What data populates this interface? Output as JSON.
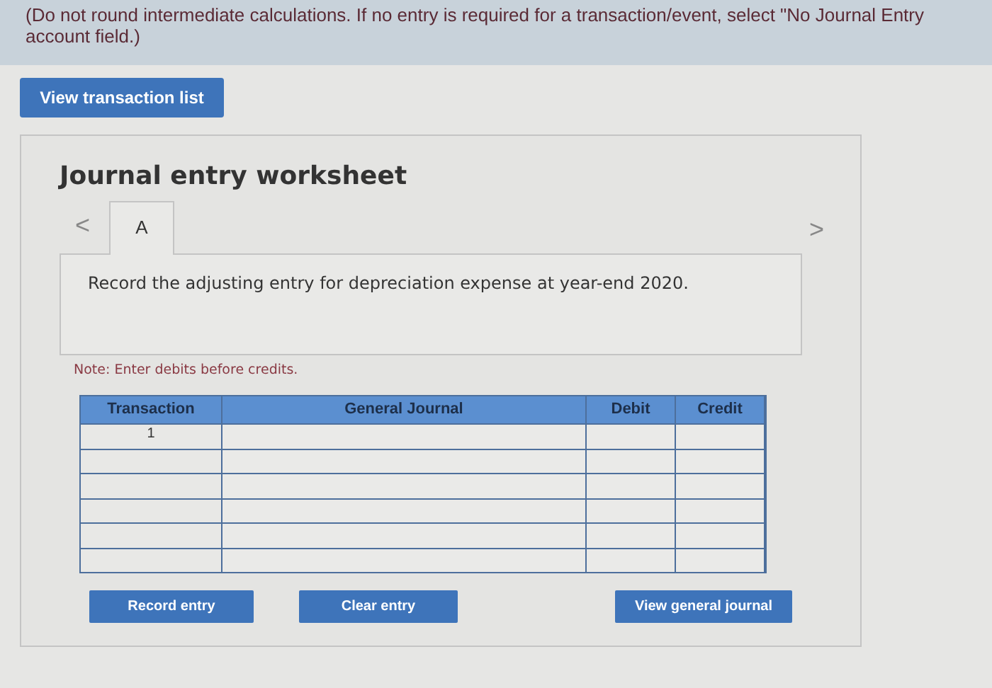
{
  "instructions": [
    "(Do not round intermediate calculations. If no entry is required for a transaction/event, select \"No Journal Entry",
    "account field.)"
  ],
  "view_transaction_button": "View transaction list",
  "worksheet": {
    "title": "Journal entry worksheet",
    "prev_arrow": "<",
    "next_arrow": ">",
    "tabs": [
      {
        "label": "A",
        "selected": true
      }
    ],
    "prompt": "Record the adjusting entry for depreciation expense at year-end 2020.",
    "note": "Note: Enter debits before credits.",
    "table": {
      "columns": [
        "Transaction",
        "General Journal",
        "Debit",
        "Credit"
      ],
      "rows": [
        {
          "transaction": "1"
        },
        {},
        {},
        {},
        {},
        {}
      ]
    },
    "buttons": [
      "Record entry",
      "Clear entry",
      "View general journal"
    ]
  }
}
